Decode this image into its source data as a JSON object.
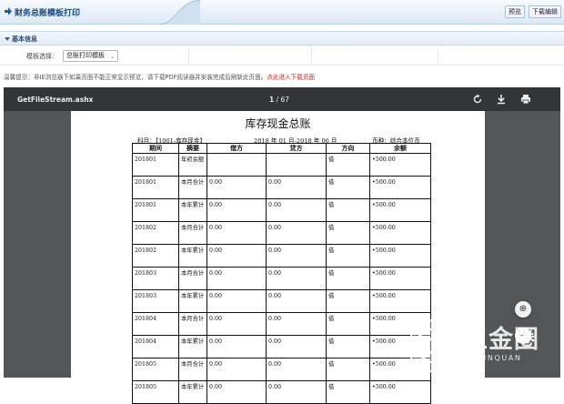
{
  "header": {
    "title": "财务总账模板打印",
    "preview_label": "预览",
    "download_label": "下载编辑"
  },
  "section": {
    "title": "基本信息"
  },
  "form": {
    "template_label": "模板选择：",
    "template_value": "总账打印模板"
  },
  "tip": {
    "text": "温馨提示：非IE浏览器下如果页面不能正常显示预览，请下载PDF阅读器并安装完成后刷新此页面。",
    "link": "点此进入下载页面"
  },
  "viewer": {
    "filename": "GetFileStream.ashx",
    "current_page": "1",
    "separator": "/",
    "total_pages": "67"
  },
  "document": {
    "title": "库存现金总账",
    "subject": "科目：【1001-库存现金】",
    "period": "2018 年 01 月-2018 年 06 月",
    "currency": "币种：综合本位币",
    "columns": [
      "期间",
      "摘要",
      "借方",
      "贷方",
      "方向",
      "余额"
    ],
    "rows": [
      [
        "201801",
        "年初余额",
        "",
        "",
        "借",
        "•500.00"
      ],
      [
        "201801",
        "本月合计",
        "0.00",
        "0.00",
        "借",
        "•500.00"
      ],
      [
        "201801",
        "本年累计",
        "0.00",
        "0.00",
        "借",
        "•500.00"
      ],
      [
        "201802",
        "本月合计",
        "0.00",
        "0.00",
        "借",
        "•500.00"
      ],
      [
        "201802",
        "本年累计",
        "0.00",
        "0.00",
        "借",
        "•500.00"
      ],
      [
        "201803",
        "本月合计",
        "0.00",
        "0.00",
        "借",
        "•500.00"
      ],
      [
        "201803",
        "本年累计",
        "0.00",
        "0.00",
        "借",
        "•500.00"
      ],
      [
        "201804",
        "本月合计",
        "0.00",
        "0.00",
        "借",
        "•500.00"
      ],
      [
        "201804",
        "本年累计",
        "0.00",
        "0.00",
        "借",
        "•500.00"
      ],
      [
        "201805",
        "本月合计",
        "0.00",
        "0.00",
        "借",
        "•500.00"
      ],
      [
        "201805",
        "本年累计",
        "0.00",
        "0.00",
        "借",
        "•500.00"
      ]
    ]
  },
  "watermark": {
    "big": "五金圈",
    "small": "WUJINQUAN"
  },
  "icons": {
    "header_arrow": "arrow-right-icon",
    "section": "triangle-down-icon",
    "rotate": "rotate-icon",
    "download": "download-icon",
    "print": "print-icon",
    "fit": "fit-page-icon",
    "zoom_in": "zoom-in-icon"
  },
  "colors": {
    "header_title": "#15488a",
    "viewer_bg": "#525659",
    "viewer_toolbar": "#323639",
    "tip_link": "#d21f1f"
  }
}
